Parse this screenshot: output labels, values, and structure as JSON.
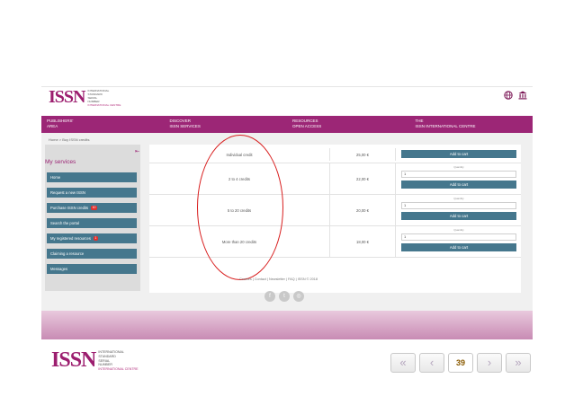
{
  "brand": {
    "mark": "ISSN",
    "lines": [
      "INTERNATIONAL",
      "STANDARD",
      "SERIAL",
      "NUMBER",
      "INTERNATIONAL CENTRE"
    ]
  },
  "header_icons": [
    "globe-icon",
    "institution-icon"
  ],
  "nav": [
    {
      "line1": "PUBLISHERS'",
      "line2": "AREA"
    },
    {
      "line1": "DISCOVER",
      "line2": "ISSN SERVICES"
    },
    {
      "line1": "RESOURCES",
      "line2": "OPEN ACCESS"
    },
    {
      "line1": "THE",
      "line2": "ISSN INTERNATIONAL CENTRE"
    }
  ],
  "breadcrumb": {
    "home": "Home",
    "sep": ">",
    "current": "Buy ISSN credits"
  },
  "sidebar": {
    "collapse_icon": "collapse-icon",
    "title": "My services",
    "items": [
      {
        "label": "Home",
        "badge": ""
      },
      {
        "label": "Request a new ISSN",
        "badge": ""
      },
      {
        "label": "Purchase ISSN credits",
        "badge": "10"
      },
      {
        "label": "Search the portal",
        "badge": ""
      },
      {
        "label": "My registered resources",
        "badge": "1"
      },
      {
        "label": "Claiming a resource",
        "badge": ""
      },
      {
        "label": "Messages",
        "badge": ""
      }
    ]
  },
  "table": {
    "quantity_label": "Quantity",
    "cart_label": "Add to cart",
    "rows": [
      {
        "name": "Individual credit",
        "price": "25,00 €",
        "qty": ""
      },
      {
        "name": "2 to 4 credits",
        "price": "22,00 €",
        "qty": "1"
      },
      {
        "name": "5 to 20 credits",
        "price": "20,00 €",
        "qty": "1"
      },
      {
        "name": "More than 20 credits",
        "price": "18,00 €",
        "qty": "1"
      }
    ]
  },
  "footer": {
    "links": "Cookies | Contact | Newsletter | FAQ | ISSN © 2018"
  },
  "social_icons": [
    "facebook-icon",
    "twitter-icon",
    "instagram-icon"
  ],
  "annotation": {
    "color": "#d81d1d"
  },
  "pager": {
    "first": "«",
    "prev": "‹",
    "page": "39",
    "next": "›",
    "last": "»"
  },
  "colors": {
    "accent": "#9c2676",
    "button": "#45778d"
  }
}
